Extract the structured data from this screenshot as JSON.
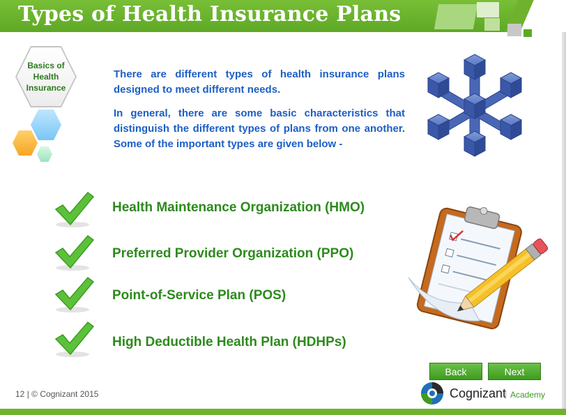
{
  "header": {
    "title": "Types of Health Insurance Plans"
  },
  "topic_badge": {
    "label_lines": [
      "Basics of",
      "Health",
      "Insurance"
    ]
  },
  "intro": {
    "paragraph_1": "There are different types of health insurance plans designed to meet different needs.",
    "paragraph_2": "In general, there are some basic characteristics that distinguish the different types of plans from one another. Some of the important types are given below  -"
  },
  "plan_types": [
    "Health Maintenance Organization (HMO)",
    "Preferred Provider Organization (PPO)",
    "Point-of-Service Plan (POS)",
    "High Deductible Health Plan (HDHPs)"
  ],
  "navigation": {
    "back_label": "Back",
    "next_label": "Next"
  },
  "footer": {
    "page_number": "12",
    "copyright": "© Cognizant 2015",
    "separator": "|",
    "brand_name": "Cognizant",
    "brand_suffix": "Academy"
  },
  "colors": {
    "header_green": "#6fb22e",
    "intro_blue": "#1d5fc4",
    "item_green": "#2d8a1d",
    "check_green": "#5cc13a"
  },
  "icons": [
    "network-cubes-icon",
    "checkmark-icon",
    "clipboard-pencil-icon",
    "cognizant-logo-icon"
  ]
}
